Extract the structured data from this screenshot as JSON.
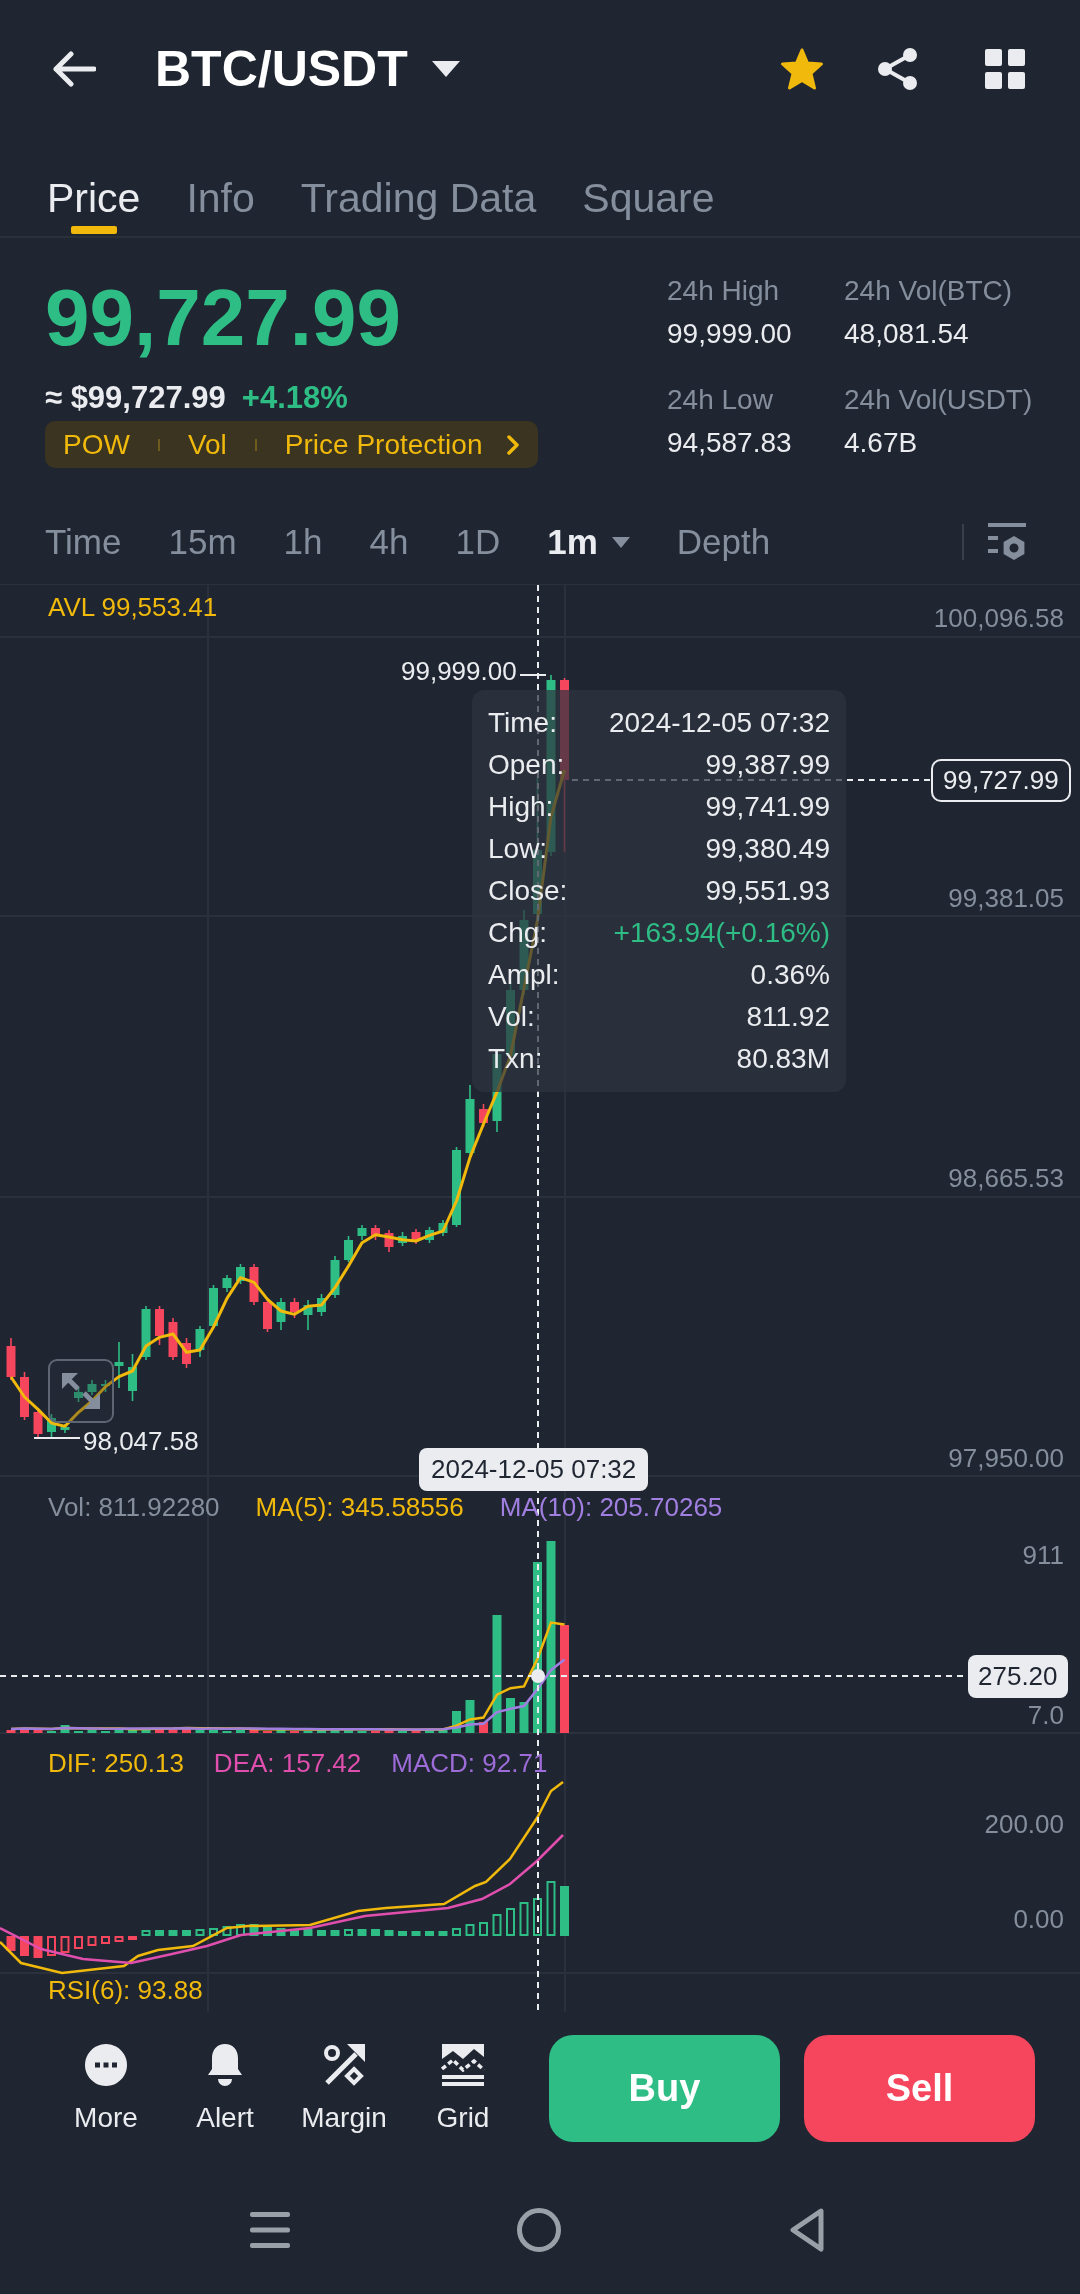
{
  "header": {
    "title": "BTC/USDT",
    "favorite": true
  },
  "tabs": [
    {
      "label": "Price",
      "selected": true
    },
    {
      "label": "Info",
      "selected": false
    },
    {
      "label": "Trading Data",
      "selected": false
    },
    {
      "label": "Square",
      "selected": false
    }
  ],
  "ticker": {
    "rising": true,
    "last_price": "99,727.99",
    "fiat_price": "≈ $99,727.99",
    "change": "+4.18%",
    "tags": [
      "POW",
      "Vol",
      "Price Protection"
    ],
    "stats": [
      {
        "label": "24h High",
        "value": "99,999.00"
      },
      {
        "label": "24h Vol(BTC)",
        "value": "48,081.54"
      },
      {
        "label": "24h Low",
        "value": "94,587.83"
      },
      {
        "label": "24h Vol(USDT)",
        "value": "4.67B"
      }
    ]
  },
  "intervals": [
    {
      "label": "Time",
      "selected": false,
      "dropdown": false
    },
    {
      "label": "15m",
      "selected": false,
      "dropdown": false
    },
    {
      "label": "1h",
      "selected": false,
      "dropdown": false
    },
    {
      "label": "4h",
      "selected": false,
      "dropdown": false
    },
    {
      "label": "1D",
      "selected": false,
      "dropdown": false
    },
    {
      "label": "1m",
      "selected": true,
      "dropdown": true
    },
    {
      "label": "Depth",
      "selected": false,
      "dropdown": false
    }
  ],
  "chart": {
    "average": "AVL 99,553.41",
    "price_axis": [
      "100,096.58",
      "99,381.05",
      "98,665.53",
      "97,950.00"
    ],
    "high_label": "99,999.00",
    "low_label": "98,047.58",
    "last_price_tag": "99,727.99",
    "crosshair_time": "2024-12-05 07:32",
    "tooltip": [
      {
        "label": "Time:",
        "value": "2024-12-05 07:32",
        "kind": "plain"
      },
      {
        "label": "Open:",
        "value": "99,387.99",
        "kind": "plain"
      },
      {
        "label": "High:",
        "value": "99,741.99",
        "kind": "plain"
      },
      {
        "label": "Low:",
        "value": "99,380.49",
        "kind": "plain"
      },
      {
        "label": "Close:",
        "value": "99,551.93",
        "kind": "plain"
      },
      {
        "label": "Chg:",
        "value": "+163.94(+0.16%)",
        "kind": "change"
      },
      {
        "label": "Ampl:",
        "value": "0.36%",
        "kind": "plain"
      },
      {
        "label": "Vol:",
        "value": "811.92",
        "kind": "plain"
      },
      {
        "label": "Txn:",
        "value": "80.83M",
        "kind": "plain"
      }
    ]
  },
  "volume": {
    "legend": [
      {
        "text": "Vol: 811.92280",
        "color": "#848e9c"
      },
      {
        "text": "MA(5): 345.58556",
        "color": "#f0b90b"
      },
      {
        "text": "MA(10): 205.70265",
        "color": "#a07fe0"
      }
    ],
    "axis": [
      "911",
      "7.0"
    ],
    "crosshair_value": "275.20"
  },
  "macd": {
    "legend": [
      {
        "text": "DIF: 250.13",
        "color": "#f0b90b"
      },
      {
        "text": "DEA: 157.42",
        "color": "#e04fae"
      },
      {
        "text": "MACD: 92.71",
        "color": "#9d6cd8"
      }
    ],
    "axis": [
      "200.00",
      "0.00"
    ]
  },
  "rsi": {
    "legend": "RSI(6): 93.88"
  },
  "toolbar": [
    {
      "label": "More",
      "kind": "more"
    },
    {
      "label": "Alert",
      "kind": "alert"
    },
    {
      "label": "Margin",
      "kind": "margin"
    },
    {
      "label": "Grid",
      "kind": "grid"
    }
  ],
  "trade_buttons": [
    {
      "label": "Buy",
      "kind": "buy"
    },
    {
      "label": "Sell",
      "kind": "sell"
    }
  ]
}
